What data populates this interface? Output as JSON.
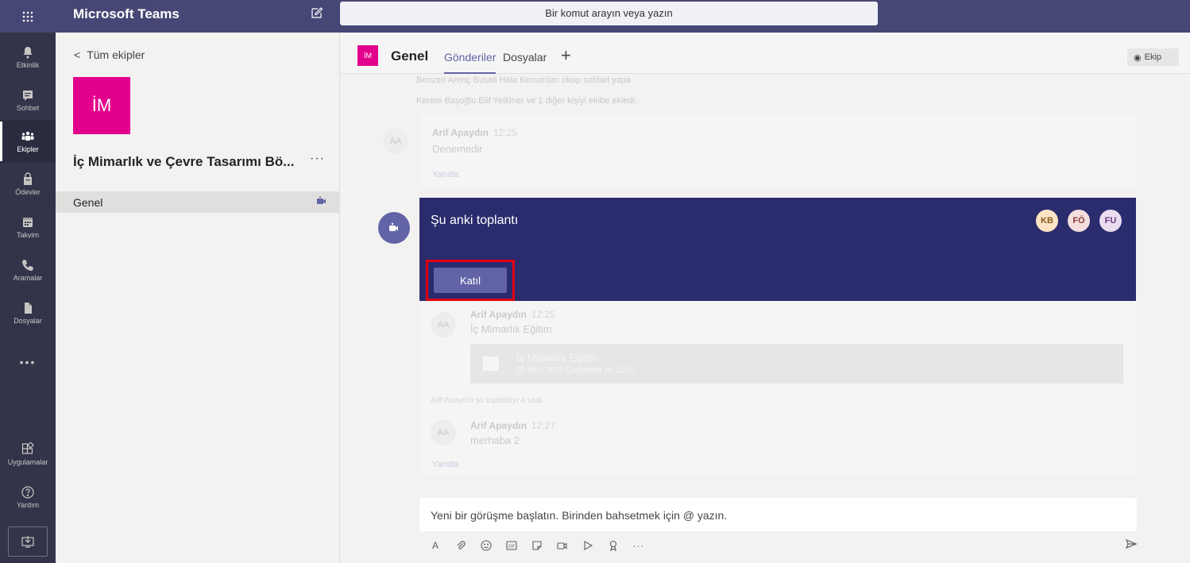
{
  "app": {
    "title": "Microsoft Teams"
  },
  "search": {
    "placeholder": "Bir komut arayın veya yazın"
  },
  "rail": {
    "items": [
      {
        "label": "Etkinlik",
        "icon": "bell-icon"
      },
      {
        "label": "Sohbet",
        "icon": "chat-icon"
      },
      {
        "label": "Ekipler",
        "icon": "teams-icon"
      },
      {
        "label": "Ödevler",
        "icon": "assignments-icon"
      },
      {
        "label": "Takvim",
        "icon": "calendar-icon"
      },
      {
        "label": "Aramalar",
        "icon": "phone-icon"
      },
      {
        "label": "Dosyalar",
        "icon": "files-icon"
      },
      {
        "label": "Uygulamalar",
        "icon": "apps-icon"
      },
      {
        "label": "Yardım",
        "icon": "help-icon"
      }
    ],
    "more": "•••"
  },
  "panel": {
    "back_label": "Tüm ekipler",
    "team_initials": "İM",
    "team_name": "İç Mimarlık ve Çevre Tasarımı Bö...",
    "team_more": "···",
    "channel": "Genel"
  },
  "channel": {
    "initials": "İM",
    "title": "Genel",
    "tabs": [
      "Gönderiler",
      "Dosyalar"
    ],
    "add_tab": "+",
    "team_button": "Ekip"
  },
  "feed": {
    "system_lines": [
      "Benzeri Arenç Buseli Hala Konumları okup sohbet yapa",
      "Kerem Başoğlu Elif Yetkiner ve 1 diğer kişiyi ekibe ekledi."
    ],
    "messages": [
      {
        "initials": "AA",
        "author": "Arif Apaydın",
        "time": "12:25",
        "text": "Denemedir",
        "reply": "Yanıtla"
      },
      {
        "initials": "AA",
        "author": "Arif Apaydın",
        "time": "12:25",
        "text": "İç Mimarlık Eğitim",
        "reply": ""
      },
      {
        "initials": "AA",
        "author": "Arif Apaydın",
        "time": "12:27",
        "text": "merhaba 2",
        "reply": "Yanıtla"
      }
    ],
    "event": {
      "title": "İç Mimarlık Eğitim",
      "subtitle": "25 Mart 2020 Çarşamba en 11:00",
      "more": "···"
    },
    "event_note": "Arif Apaydın şu toplantıyı 4 saat"
  },
  "meeting": {
    "title": "Şu anki toplantı",
    "join_label": "Katıl",
    "participants": [
      {
        "initials": "KB",
        "bg": "#fce4c4",
        "fg": "#8a5a1f"
      },
      {
        "initials": "FÖ",
        "bg": "#f4dede",
        "fg": "#8a3a3a"
      },
      {
        "initials": "FU",
        "bg": "#eadcf0",
        "fg": "#6a3a7a"
      }
    ]
  },
  "compose": {
    "placeholder": "Yeni bir görüşme başlatın. Birinden bahsetmek için @ yazın.",
    "tools": [
      "format-icon",
      "attach-icon",
      "emoji-icon",
      "gif-icon",
      "sticker-icon",
      "meet-now-icon",
      "stream-icon",
      "praise-icon",
      "more-icon"
    ]
  },
  "colors": {
    "brand": "#464775",
    "rail": "#33344a",
    "accent": "#6264a7",
    "team_avatar": "#e3008c",
    "meeting_card": "#2b2c6e",
    "highlight": "#e00012"
  }
}
